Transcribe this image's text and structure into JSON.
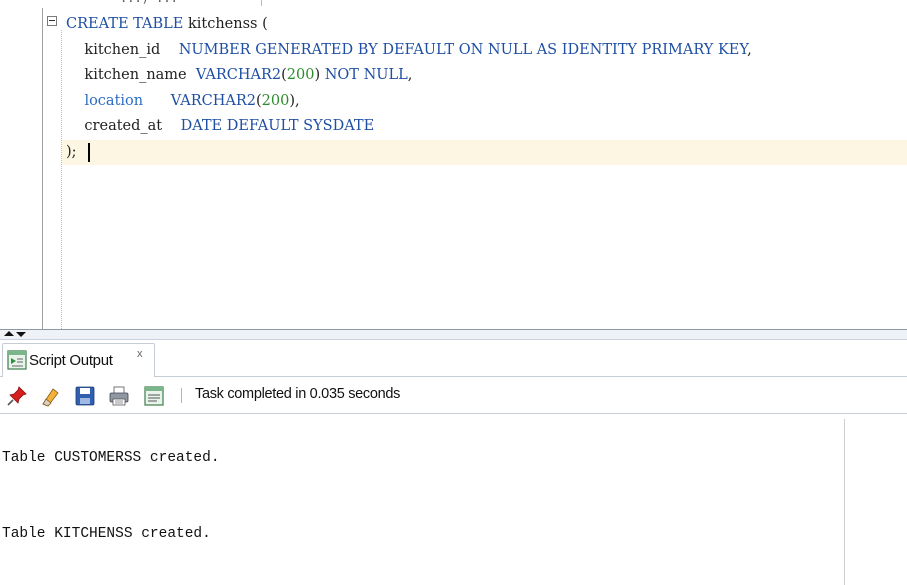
{
  "editor": {
    "tab_fragment": "...) ...",
    "lines": [
      {
        "tokens": [
          {
            "t": "CREATE TABLE ",
            "c": "kw"
          },
          {
            "t": "kitchenss",
            "c": "id"
          },
          {
            "t": " (",
            "c": "id"
          }
        ]
      },
      {
        "tokens": [
          {
            "t": "    kitchen_id    ",
            "c": "id"
          },
          {
            "t": "NUMBER GENERATED BY DEFAULT ON NULL AS IDENTITY PRIMARY KEY",
            "c": "kw"
          },
          {
            "t": ",",
            "c": "id"
          }
        ]
      },
      {
        "tokens": [
          {
            "t": "    kitchen_name  ",
            "c": "id"
          },
          {
            "t": "VARCHAR2",
            "c": "kw"
          },
          {
            "t": "(",
            "c": "id"
          },
          {
            "t": "200",
            "c": "num"
          },
          {
            "t": ") ",
            "c": "id"
          },
          {
            "t": "NOT NULL",
            "c": "kw"
          },
          {
            "t": ",",
            "c": "id"
          }
        ]
      },
      {
        "tokens": [
          {
            "t": "    ",
            "c": "id"
          },
          {
            "t": "location",
            "c": "col-special"
          },
          {
            "t": "      ",
            "c": "id"
          },
          {
            "t": "VARCHAR2",
            "c": "kw"
          },
          {
            "t": "(",
            "c": "id"
          },
          {
            "t": "200",
            "c": "num"
          },
          {
            "t": "),",
            "c": "id"
          }
        ]
      },
      {
        "tokens": [
          {
            "t": "    created_at    ",
            "c": "id"
          },
          {
            "t": "DATE DEFAULT SYSDATE",
            "c": "kw"
          }
        ]
      },
      {
        "tokens": [
          {
            "t": ");",
            "c": "id"
          }
        ]
      }
    ]
  },
  "output_panel": {
    "tab_label": "Script Output",
    "tab_close": "x",
    "toolbar": {
      "buttons": [
        {
          "name": "pin-icon",
          "title": "Freeze View"
        },
        {
          "name": "eraser-icon",
          "title": "Clear"
        },
        {
          "name": "save-icon",
          "title": "Save"
        },
        {
          "name": "print-icon",
          "title": "Print"
        },
        {
          "name": "script-icon",
          "title": "Open in Worksheet"
        }
      ],
      "status": "Task completed in 0.035 seconds"
    },
    "messages": [
      "Table CUSTOMERSS created.",
      "Table KITCHENSS created."
    ]
  },
  "colors": {
    "keyword": "#1f4fa3",
    "number": "#2c8c2c",
    "current_line": "#fdf6e3"
  }
}
